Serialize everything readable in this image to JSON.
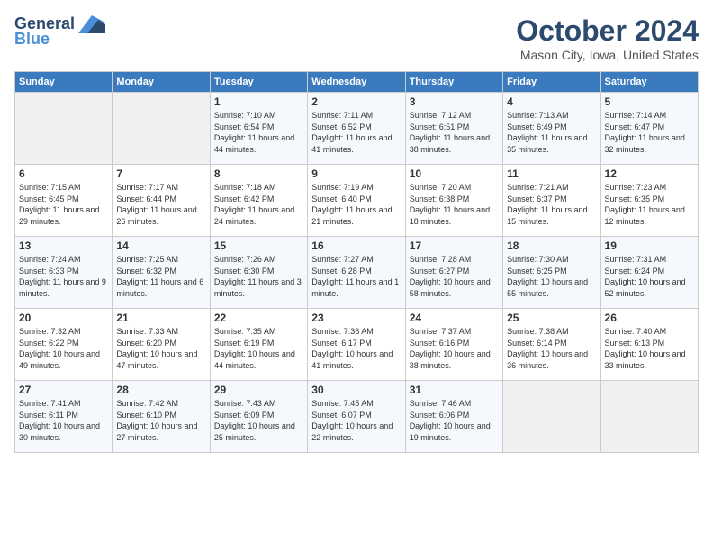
{
  "logo": {
    "line1": "General",
    "line2": "Blue"
  },
  "title": "October 2024",
  "subtitle": "Mason City, Iowa, United States",
  "headers": [
    "Sunday",
    "Monday",
    "Tuesday",
    "Wednesday",
    "Thursday",
    "Friday",
    "Saturday"
  ],
  "weeks": [
    [
      {
        "day": "",
        "sunrise": "",
        "sunset": "",
        "daylight": ""
      },
      {
        "day": "",
        "sunrise": "",
        "sunset": "",
        "daylight": ""
      },
      {
        "day": "1",
        "sunrise": "Sunrise: 7:10 AM",
        "sunset": "Sunset: 6:54 PM",
        "daylight": "Daylight: 11 hours and 44 minutes."
      },
      {
        "day": "2",
        "sunrise": "Sunrise: 7:11 AM",
        "sunset": "Sunset: 6:52 PM",
        "daylight": "Daylight: 11 hours and 41 minutes."
      },
      {
        "day": "3",
        "sunrise": "Sunrise: 7:12 AM",
        "sunset": "Sunset: 6:51 PM",
        "daylight": "Daylight: 11 hours and 38 minutes."
      },
      {
        "day": "4",
        "sunrise": "Sunrise: 7:13 AM",
        "sunset": "Sunset: 6:49 PM",
        "daylight": "Daylight: 11 hours and 35 minutes."
      },
      {
        "day": "5",
        "sunrise": "Sunrise: 7:14 AM",
        "sunset": "Sunset: 6:47 PM",
        "daylight": "Daylight: 11 hours and 32 minutes."
      }
    ],
    [
      {
        "day": "6",
        "sunrise": "Sunrise: 7:15 AM",
        "sunset": "Sunset: 6:45 PM",
        "daylight": "Daylight: 11 hours and 29 minutes."
      },
      {
        "day": "7",
        "sunrise": "Sunrise: 7:17 AM",
        "sunset": "Sunset: 6:44 PM",
        "daylight": "Daylight: 11 hours and 26 minutes."
      },
      {
        "day": "8",
        "sunrise": "Sunrise: 7:18 AM",
        "sunset": "Sunset: 6:42 PM",
        "daylight": "Daylight: 11 hours and 24 minutes."
      },
      {
        "day": "9",
        "sunrise": "Sunrise: 7:19 AM",
        "sunset": "Sunset: 6:40 PM",
        "daylight": "Daylight: 11 hours and 21 minutes."
      },
      {
        "day": "10",
        "sunrise": "Sunrise: 7:20 AM",
        "sunset": "Sunset: 6:38 PM",
        "daylight": "Daylight: 11 hours and 18 minutes."
      },
      {
        "day": "11",
        "sunrise": "Sunrise: 7:21 AM",
        "sunset": "Sunset: 6:37 PM",
        "daylight": "Daylight: 11 hours and 15 minutes."
      },
      {
        "day": "12",
        "sunrise": "Sunrise: 7:23 AM",
        "sunset": "Sunset: 6:35 PM",
        "daylight": "Daylight: 11 hours and 12 minutes."
      }
    ],
    [
      {
        "day": "13",
        "sunrise": "Sunrise: 7:24 AM",
        "sunset": "Sunset: 6:33 PM",
        "daylight": "Daylight: 11 hours and 9 minutes."
      },
      {
        "day": "14",
        "sunrise": "Sunrise: 7:25 AM",
        "sunset": "Sunset: 6:32 PM",
        "daylight": "Daylight: 11 hours and 6 minutes."
      },
      {
        "day": "15",
        "sunrise": "Sunrise: 7:26 AM",
        "sunset": "Sunset: 6:30 PM",
        "daylight": "Daylight: 11 hours and 3 minutes."
      },
      {
        "day": "16",
        "sunrise": "Sunrise: 7:27 AM",
        "sunset": "Sunset: 6:28 PM",
        "daylight": "Daylight: 11 hours and 1 minute."
      },
      {
        "day": "17",
        "sunrise": "Sunrise: 7:28 AM",
        "sunset": "Sunset: 6:27 PM",
        "daylight": "Daylight: 10 hours and 58 minutes."
      },
      {
        "day": "18",
        "sunrise": "Sunrise: 7:30 AM",
        "sunset": "Sunset: 6:25 PM",
        "daylight": "Daylight: 10 hours and 55 minutes."
      },
      {
        "day": "19",
        "sunrise": "Sunrise: 7:31 AM",
        "sunset": "Sunset: 6:24 PM",
        "daylight": "Daylight: 10 hours and 52 minutes."
      }
    ],
    [
      {
        "day": "20",
        "sunrise": "Sunrise: 7:32 AM",
        "sunset": "Sunset: 6:22 PM",
        "daylight": "Daylight: 10 hours and 49 minutes."
      },
      {
        "day": "21",
        "sunrise": "Sunrise: 7:33 AM",
        "sunset": "Sunset: 6:20 PM",
        "daylight": "Daylight: 10 hours and 47 minutes."
      },
      {
        "day": "22",
        "sunrise": "Sunrise: 7:35 AM",
        "sunset": "Sunset: 6:19 PM",
        "daylight": "Daylight: 10 hours and 44 minutes."
      },
      {
        "day": "23",
        "sunrise": "Sunrise: 7:36 AM",
        "sunset": "Sunset: 6:17 PM",
        "daylight": "Daylight: 10 hours and 41 minutes."
      },
      {
        "day": "24",
        "sunrise": "Sunrise: 7:37 AM",
        "sunset": "Sunset: 6:16 PM",
        "daylight": "Daylight: 10 hours and 38 minutes."
      },
      {
        "day": "25",
        "sunrise": "Sunrise: 7:38 AM",
        "sunset": "Sunset: 6:14 PM",
        "daylight": "Daylight: 10 hours and 36 minutes."
      },
      {
        "day": "26",
        "sunrise": "Sunrise: 7:40 AM",
        "sunset": "Sunset: 6:13 PM",
        "daylight": "Daylight: 10 hours and 33 minutes."
      }
    ],
    [
      {
        "day": "27",
        "sunrise": "Sunrise: 7:41 AM",
        "sunset": "Sunset: 6:11 PM",
        "daylight": "Daylight: 10 hours and 30 minutes."
      },
      {
        "day": "28",
        "sunrise": "Sunrise: 7:42 AM",
        "sunset": "Sunset: 6:10 PM",
        "daylight": "Daylight: 10 hours and 27 minutes."
      },
      {
        "day": "29",
        "sunrise": "Sunrise: 7:43 AM",
        "sunset": "Sunset: 6:09 PM",
        "daylight": "Daylight: 10 hours and 25 minutes."
      },
      {
        "day": "30",
        "sunrise": "Sunrise: 7:45 AM",
        "sunset": "Sunset: 6:07 PM",
        "daylight": "Daylight: 10 hours and 22 minutes."
      },
      {
        "day": "31",
        "sunrise": "Sunrise: 7:46 AM",
        "sunset": "Sunset: 6:06 PM",
        "daylight": "Daylight: 10 hours and 19 minutes."
      },
      {
        "day": "",
        "sunrise": "",
        "sunset": "",
        "daylight": ""
      },
      {
        "day": "",
        "sunrise": "",
        "sunset": "",
        "daylight": ""
      }
    ]
  ]
}
